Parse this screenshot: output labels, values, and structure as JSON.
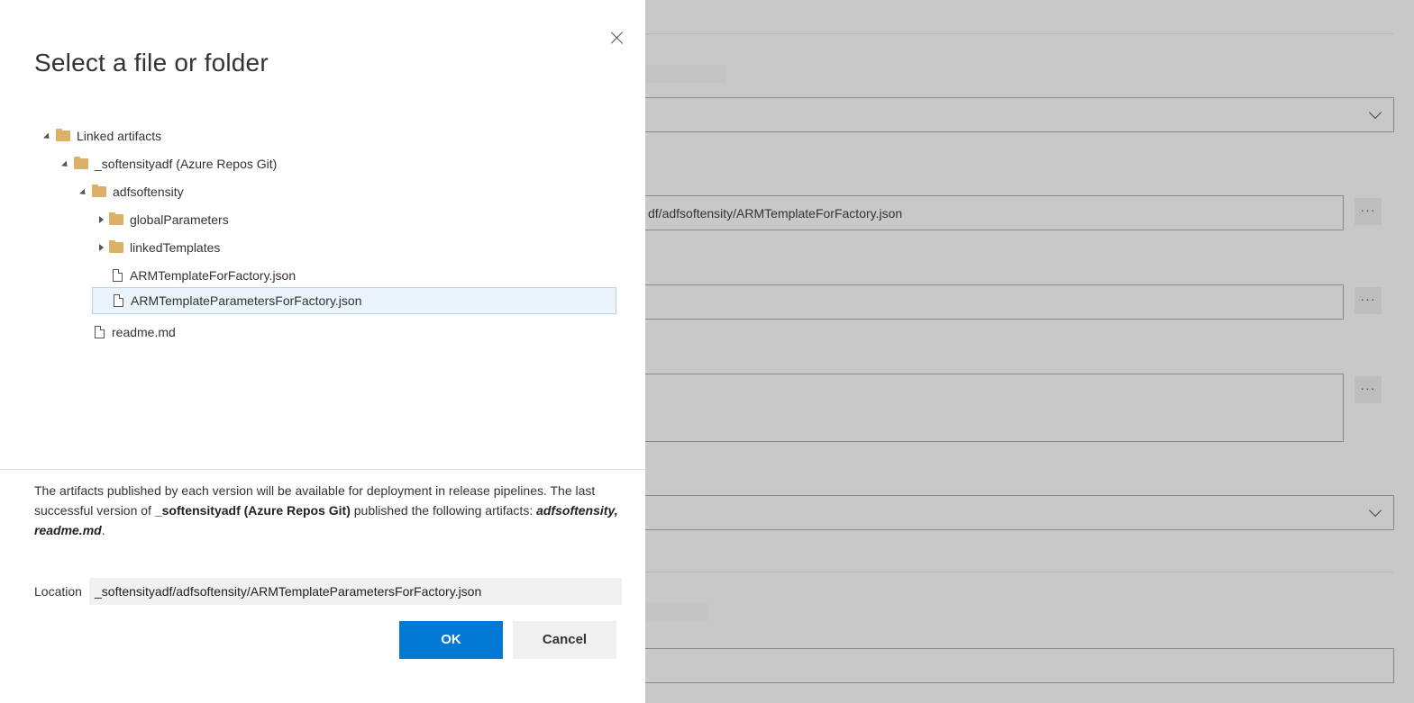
{
  "background": {
    "template_file_value": "df/adfsoftensity/ARMTemplateForFactory.json",
    "more_label": "···"
  },
  "dialog": {
    "title": "Select a file or folder",
    "tree": [
      {
        "label": "Linked artifacts",
        "type": "folder",
        "expanded": true
      },
      {
        "label": "_softensityadf (Azure Repos Git)",
        "type": "folder",
        "expanded": true
      },
      {
        "label": "adfsoftensity",
        "type": "folder",
        "expanded": true
      },
      {
        "label": "globalParameters",
        "type": "folder",
        "expanded": false
      },
      {
        "label": "linkedTemplates",
        "type": "folder",
        "expanded": false
      },
      {
        "label": "ARMTemplateForFactory.json",
        "type": "file"
      },
      {
        "label": "ARMTemplateParametersForFactory.json",
        "type": "file",
        "selected": true
      },
      {
        "label": "readme.md",
        "type": "file"
      }
    ],
    "info": {
      "line1": "The artifacts published by each version will be available for deployment in release pipelines. The last successful version of ",
      "repo": "_softensityadf (Azure Repos Git)",
      "line2": " published the following artifacts: ",
      "artifacts": "adfsoftensity, readme.md",
      "end": "."
    },
    "location_label": "Location",
    "location_value": "_softensityadf/adfsoftensity/ARMTemplateParametersForFactory.json",
    "ok_label": "OK",
    "cancel_label": "Cancel"
  },
  "colors": {
    "primary": "#0078d4",
    "folder": "#dcb067",
    "selected_bg": "#eaf4fc"
  }
}
